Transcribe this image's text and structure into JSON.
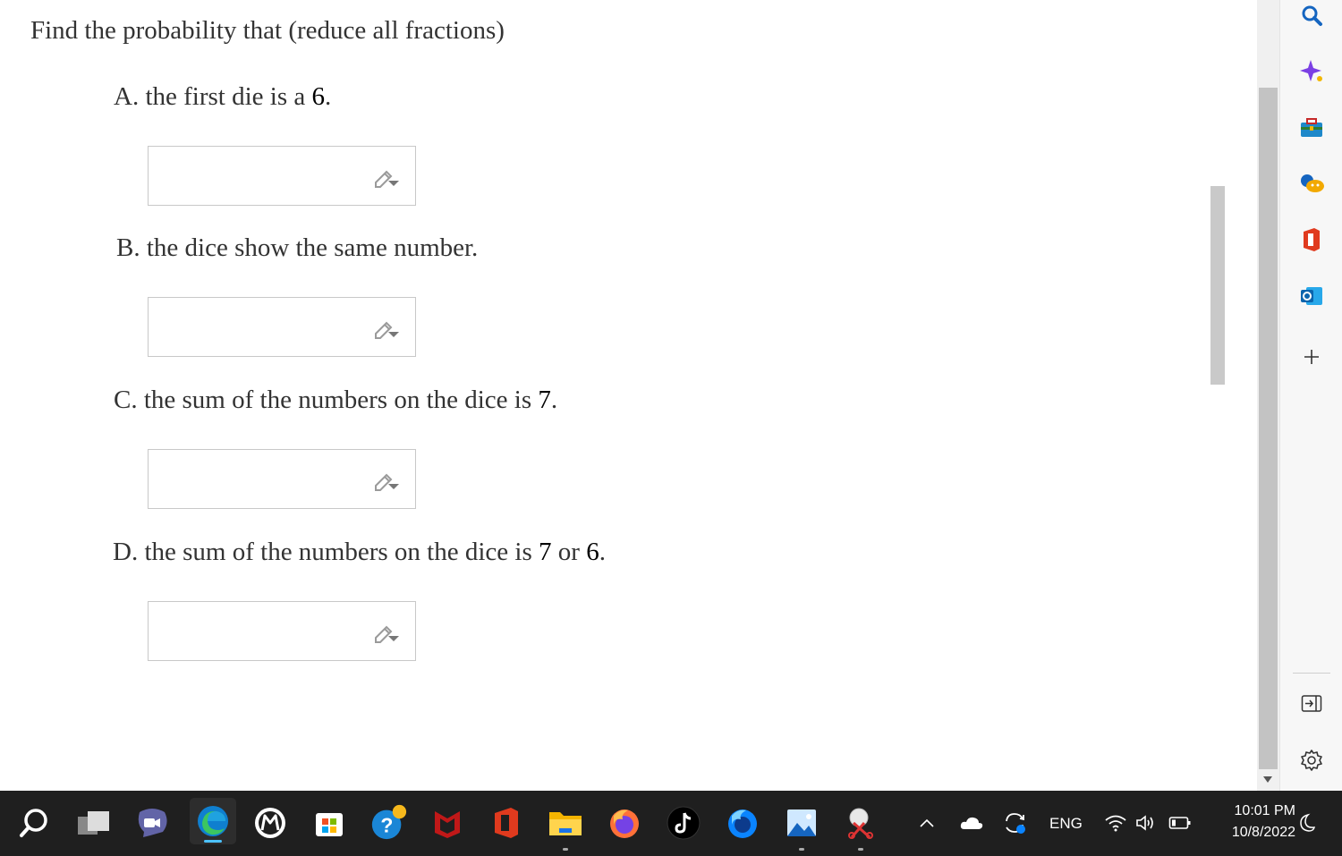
{
  "problem": {
    "prompt": "Find the probability that (reduce all fractions)",
    "questions": [
      {
        "letter": "A.",
        "text_before": "the first die is a",
        "n1": "6",
        "mid": "",
        "n2": "",
        "end": "."
      },
      {
        "letter": "B.",
        "text_before": "the dice show the same number.",
        "n1": "",
        "mid": "",
        "n2": "",
        "end": ""
      },
      {
        "letter": "C.",
        "text_before": "the sum of the numbers on the dice is",
        "n1": "7",
        "mid": "",
        "n2": "",
        "end": "."
      },
      {
        "letter": "D.",
        "text_before": "the sum of the numbers on the dice is",
        "n1": "7",
        "mid": "or",
        "n2": "6",
        "end": "."
      }
    ],
    "answers": [
      "",
      "",
      "",
      ""
    ]
  },
  "sidebar": {
    "items": [
      "search-icon",
      "copilot-icon",
      "tools-icon",
      "games-icon",
      "office-icon",
      "outlook-icon",
      "add-icon"
    ],
    "bottom": [
      "hide-sidebar-icon",
      "settings-icon"
    ]
  },
  "taskbar": {
    "apps": [
      "search",
      "task-view",
      "teams-chat",
      "edge",
      "chrome-like",
      "microsoft-store",
      "help",
      "mcafee",
      "office",
      "file-explorer",
      "firefox",
      "tiktok",
      "firefox-dev",
      "photos",
      "snipping-tool"
    ],
    "language": "ENG",
    "time": "10:01 PM",
    "date": "10/8/2022"
  },
  "colors": {
    "taskbar_bg": "#1f1f1f",
    "edge_accent": "#0078d4"
  }
}
